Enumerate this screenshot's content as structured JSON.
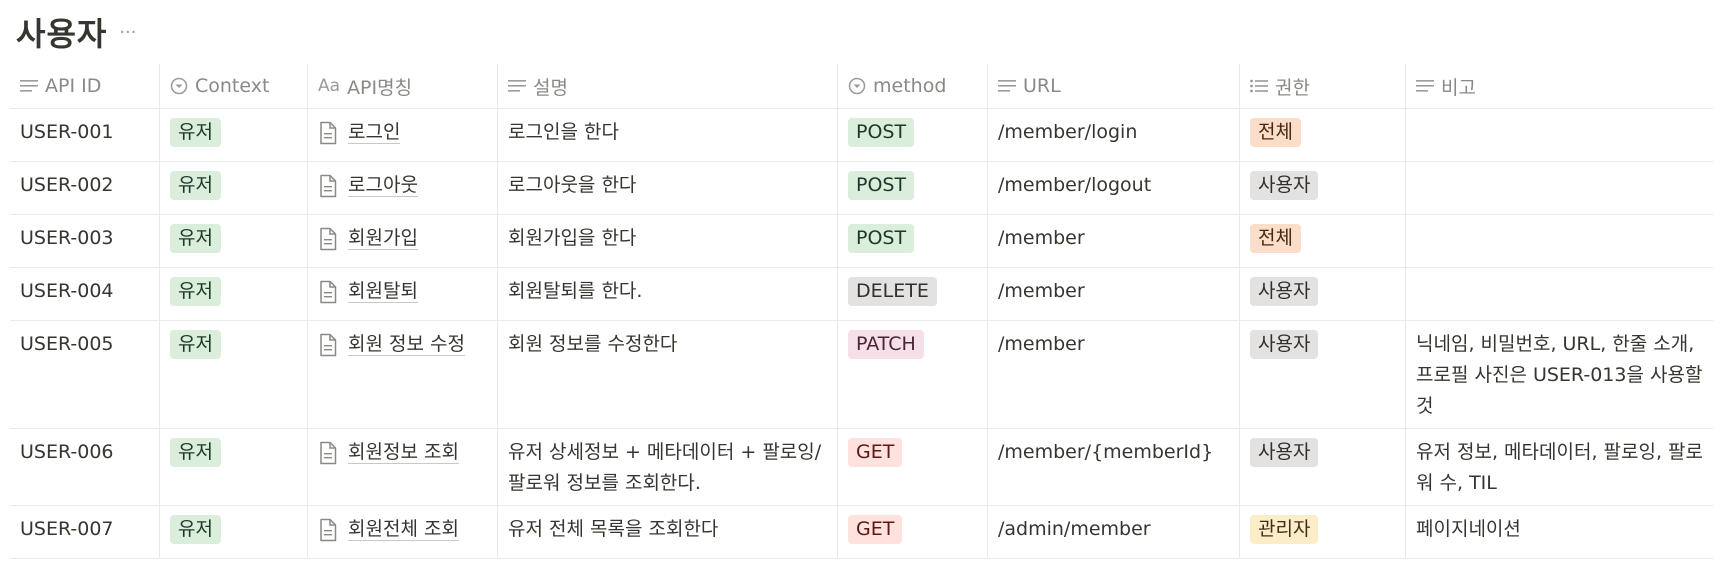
{
  "page": {
    "title": "사용자",
    "more": "···"
  },
  "columns": [
    {
      "label": "API ID",
      "icon": "text-lines-icon"
    },
    {
      "label": "Context",
      "icon": "select-icon"
    },
    {
      "label": "API명칭",
      "icon": "title-aa-icon",
      "icon_text": "Aa"
    },
    {
      "label": "설명",
      "icon": "text-lines-icon"
    },
    {
      "label": "method",
      "icon": "select-icon"
    },
    {
      "label": "URL",
      "icon": "text-lines-icon"
    },
    {
      "label": "권한",
      "icon": "multi-select-icon"
    },
    {
      "label": "비고",
      "icon": "text-lines-icon"
    }
  ],
  "rows": [
    {
      "id": "USER-001",
      "context": "유저",
      "name": "로그인",
      "desc": "로그인을 한다",
      "method": "POST",
      "url": "/member/login",
      "perm": "전체",
      "note": ""
    },
    {
      "id": "USER-002",
      "context": "유저",
      "name": "로그아웃",
      "desc": "로그아웃을 한다",
      "method": "POST",
      "url": "/member/logout",
      "perm": "사용자",
      "note": ""
    },
    {
      "id": "USER-003",
      "context": "유저",
      "name": "회원가입",
      "desc": "회원가입을 한다",
      "method": "POST",
      "url": "/member",
      "perm": "전체",
      "note": ""
    },
    {
      "id": "USER-004",
      "context": "유저",
      "name": "회원탈퇴",
      "desc": "회원탈퇴를 한다.",
      "method": "DELETE",
      "url": "/member",
      "perm": "사용자",
      "note": ""
    },
    {
      "id": "USER-005",
      "context": "유저",
      "name": "회원 정보 수정",
      "desc": "회원 정보를 수정한다",
      "method": "PATCH",
      "url": "/member",
      "perm": "사용자",
      "note": "닉네임, 비밀번호, URL, 한줄 소개, 프로필 사진은 USER-013을 사용할 것"
    },
    {
      "id": "USER-006",
      "context": "유저",
      "name": "회원정보 조회",
      "desc": "유저 상세정보 + 메타데이터 + 팔로잉/팔로워 정보를 조회한다.",
      "method": "GET",
      "url": "/member/{memberId}",
      "perm": "사용자",
      "note": "유저 정보, 메타데이터, 팔로잉, 팔로워 수, TIL"
    },
    {
      "id": "USER-007",
      "context": "유저",
      "name": "회원전체 조회",
      "desc": "유저 전체 목록을 조회한다",
      "method": "GET",
      "url": "/admin/member",
      "perm": "관리자",
      "note": "페이지네이션"
    }
  ],
  "colors": {
    "method": {
      "POST": "m-post",
      "DELETE": "m-delete",
      "PATCH": "m-patch",
      "GET": "m-get"
    },
    "perm": {
      "전체": "p-all",
      "사용자": "p-user",
      "관리자": "p-admin"
    }
  }
}
